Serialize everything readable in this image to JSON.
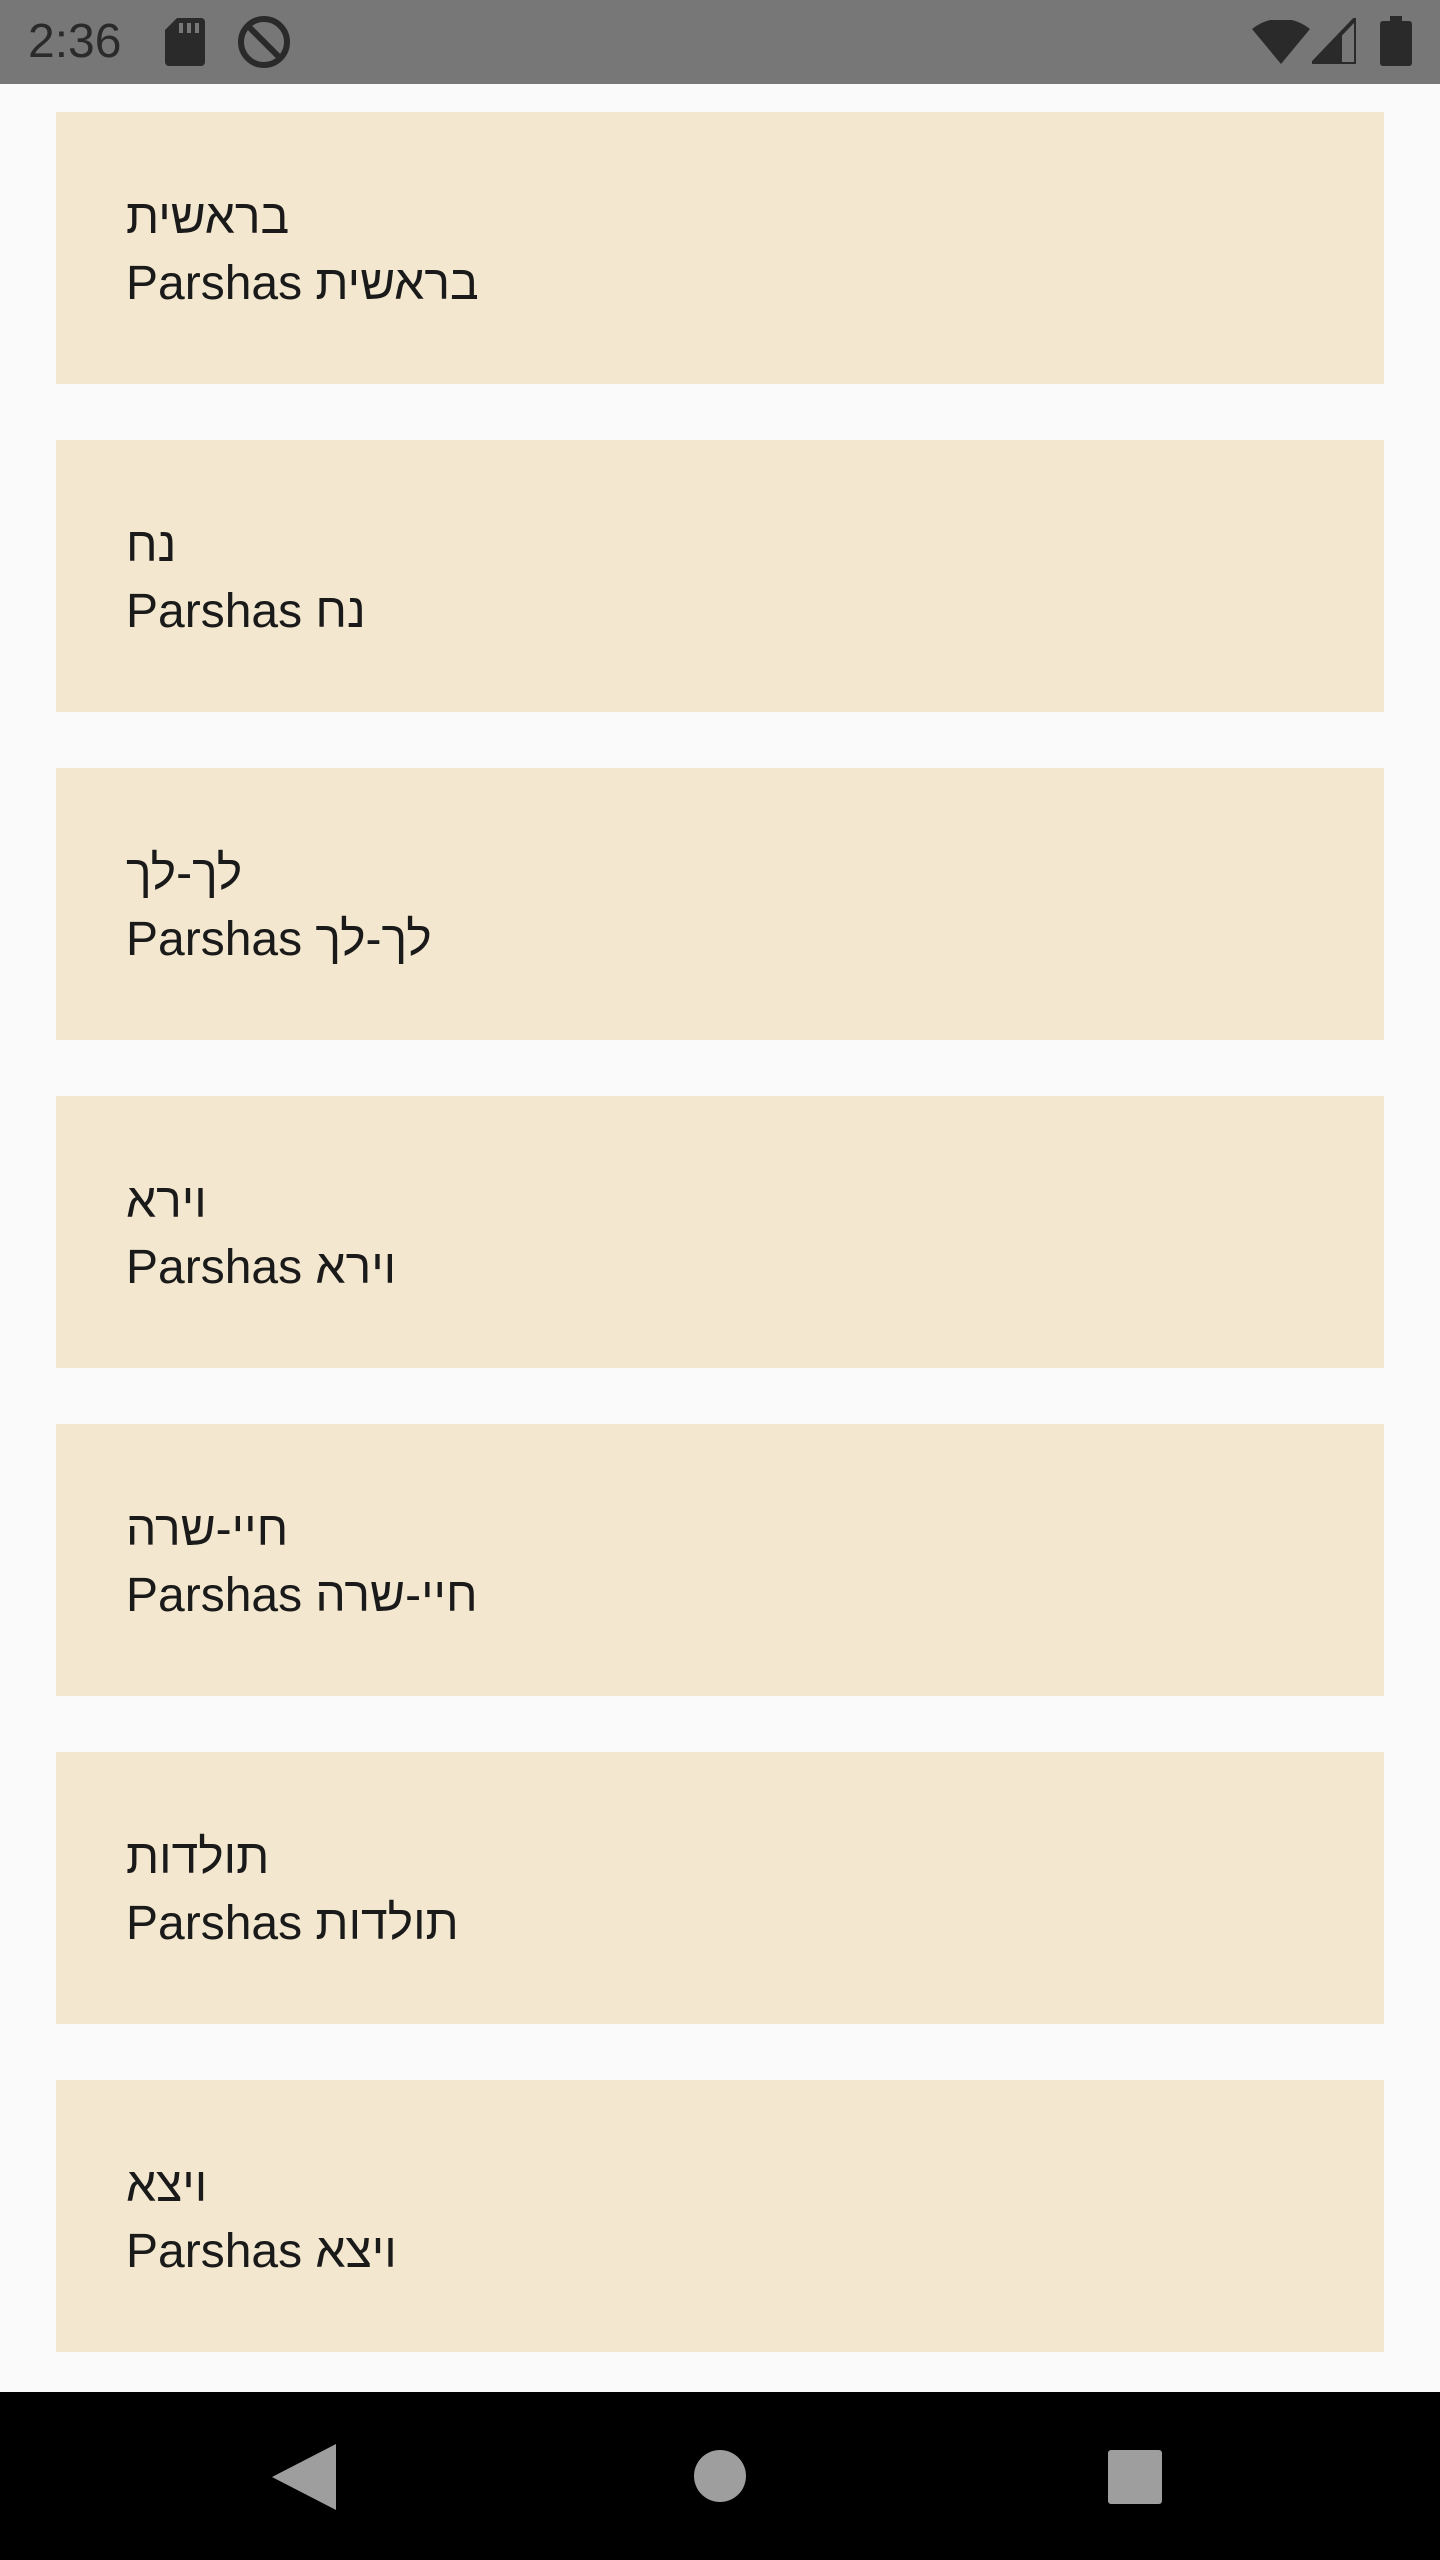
{
  "status_bar": {
    "time": "2:36",
    "icons": [
      "sdcard-icon",
      "do-not-disturb-icon",
      "wifi-icon",
      "signal-icon",
      "battery-icon"
    ],
    "colors": {
      "background": "#777777",
      "foreground": "#2a2a2a"
    }
  },
  "parshas": [
    {
      "title": "בראשית",
      "subtitle": "Parshas בראשית"
    },
    {
      "title": "נח",
      "subtitle": "Parshas נח"
    },
    {
      "title": "לך-לך",
      "subtitle": "Parshas לך-לך"
    },
    {
      "title": "וירא",
      "subtitle": "Parshas וירא"
    },
    {
      "title": "חיי-שרה",
      "subtitle": "Parshas חיי-שרה"
    },
    {
      "title": "תולדות",
      "subtitle": "Parshas תולדות"
    },
    {
      "title": "ויצא",
      "subtitle": "Parshas ויצא"
    }
  ],
  "colors": {
    "card": "#f3e8cf",
    "page": "#fafafa",
    "text": "#1a1a1a",
    "nav_bar": "#000000",
    "nav_icon": "#9e9e9e"
  },
  "nav_bar": {
    "icons": [
      "back-icon",
      "home-icon",
      "recents-icon"
    ]
  }
}
